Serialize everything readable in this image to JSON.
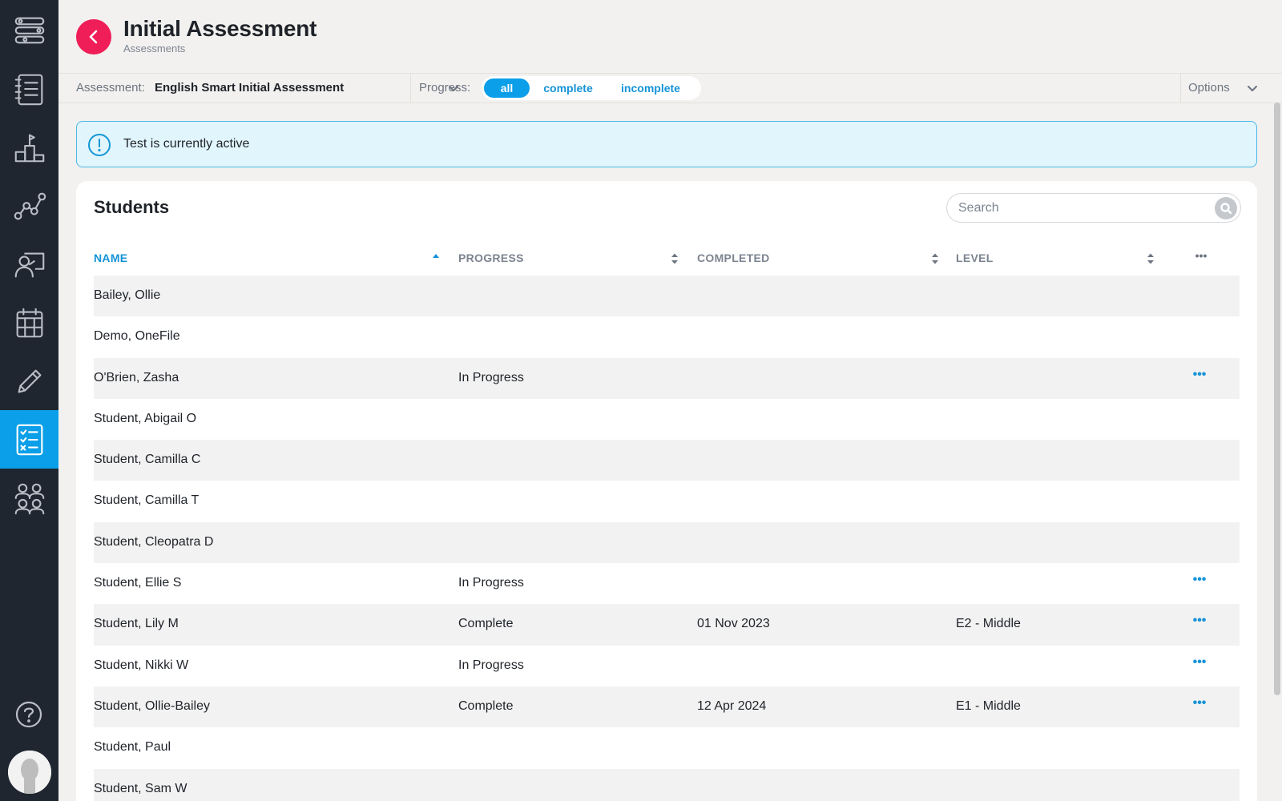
{
  "header": {
    "title": "Initial Assessment",
    "subtitle": "Assessments"
  },
  "filters": {
    "assessment_label": "Assessment:",
    "assessment_value": "English Smart Initial Assessment",
    "progress_label": "Progress:",
    "progress_options": [
      "all",
      "complete",
      "incomplete"
    ],
    "progress_selected": "all",
    "options_label": "Options"
  },
  "alert": {
    "text": "Test is currently active"
  },
  "students": {
    "title": "Students",
    "search_placeholder": "Search",
    "columns": [
      "NAME",
      "PROGRESS",
      "COMPLETED",
      "LEVEL"
    ],
    "sorted_column": "NAME",
    "sort_direction": "ascending",
    "rows": [
      {
        "name": "Bailey, Ollie",
        "progress": "",
        "completed": "",
        "level": "",
        "has_menu": false
      },
      {
        "name": "Demo, OneFile",
        "progress": "",
        "completed": "",
        "level": "",
        "has_menu": false
      },
      {
        "name": "O'Brien, Zasha",
        "progress": "In Progress",
        "completed": "",
        "level": "",
        "has_menu": true
      },
      {
        "name": "Student, Abigail O",
        "progress": "",
        "completed": "",
        "level": "",
        "has_menu": false
      },
      {
        "name": "Student, Camilla C",
        "progress": "",
        "completed": "",
        "level": "",
        "has_menu": false
      },
      {
        "name": "Student, Camilla T",
        "progress": "",
        "completed": "",
        "level": "",
        "has_menu": false
      },
      {
        "name": "Student, Cleopatra D",
        "progress": "",
        "completed": "",
        "level": "",
        "has_menu": false
      },
      {
        "name": "Student, Ellie S",
        "progress": "In Progress",
        "completed": "",
        "level": "",
        "has_menu": true
      },
      {
        "name": "Student, Lily M",
        "progress": "Complete",
        "completed": "01 Nov 2023",
        "level": "E2 - Middle",
        "has_menu": true
      },
      {
        "name": "Student, Nikki W",
        "progress": "In Progress",
        "completed": "",
        "level": "",
        "has_menu": true
      },
      {
        "name": "Student, Ollie-Bailey",
        "progress": "Complete",
        "completed": "12 Apr 2024",
        "level": "E1 - Middle",
        "has_menu": true
      },
      {
        "name": "Student, Paul",
        "progress": "",
        "completed": "",
        "level": "",
        "has_menu": false
      },
      {
        "name": "Student, Sam W",
        "progress": "",
        "completed": "",
        "level": "",
        "has_menu": false
      }
    ],
    "row_menu_glyph": "•••"
  },
  "sidebar": {
    "items": [
      {
        "icon": "workflow-icon"
      },
      {
        "icon": "document-list-icon"
      },
      {
        "icon": "podium-icon"
      },
      {
        "icon": "progress-graph-icon"
      },
      {
        "icon": "learner-board-icon"
      },
      {
        "icon": "calendar-icon"
      },
      {
        "icon": "pencil-icon"
      },
      {
        "icon": "checklist-icon",
        "active": true
      },
      {
        "icon": "group-icon"
      }
    ],
    "help_icon": "help-icon",
    "avatar_icon": "avatar-icon"
  },
  "colors": {
    "sidebar_bg": "#1f2630",
    "accent": "#0a9fe8",
    "back_button": "#ef1d58",
    "alert_bg": "#e1f5fc",
    "alert_border": "#4bb8e6"
  }
}
